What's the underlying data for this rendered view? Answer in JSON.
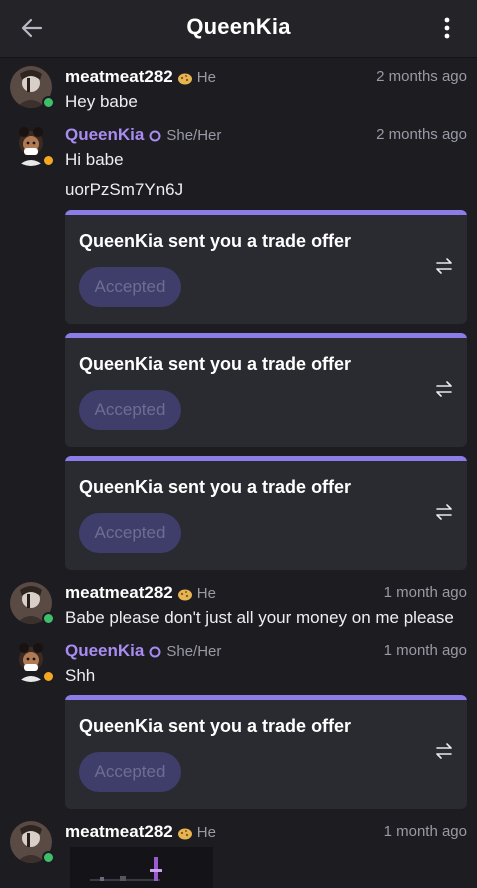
{
  "header": {
    "title": "QueenKia",
    "back_icon": "back-arrow-icon",
    "menu_icon": "more-vertical-icon"
  },
  "users": {
    "meat": {
      "name": "meatmeat282",
      "pronoun": "He",
      "status_color": "#3fbf6a"
    },
    "kia": {
      "name": "QueenKia",
      "pronoun": "She/Her",
      "status_color": "#f5a623"
    }
  },
  "messages": [
    {
      "time": "2 months ago",
      "text": "Hey babe"
    },
    {
      "time": "2 months ago",
      "text": "Hi babe",
      "extra": "uorPzSm7Yn6J"
    },
    {
      "time": "1 month ago",
      "text": "Babe please don't just all your money on me please"
    },
    {
      "time": "1 month ago",
      "text": "Shh"
    },
    {
      "time": "1 month ago"
    }
  ],
  "trade": {
    "title": "QueenKia sent you a trade offer",
    "status": "Accepted",
    "icon": "swap-arrows-icon"
  },
  "colors": {
    "accent": "#8a7de8",
    "accepted_bg": "#3f3d6a",
    "name_purple": "#a98cf2"
  }
}
